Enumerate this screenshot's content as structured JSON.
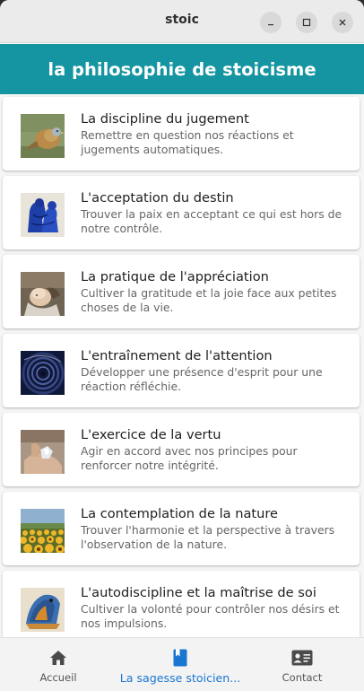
{
  "window": {
    "title": "stoic"
  },
  "appbar": {
    "title": "la philosophie de stoicisme",
    "color": "#1595a1"
  },
  "practices": [
    {
      "title": "La discipline du jugement",
      "subtitle": "Remettre en question nos réactions et jugements automatiques.",
      "image": "bird-painting"
    },
    {
      "title": "L'acceptation du destin",
      "subtitle": "Trouver la paix en acceptant ce qui est hors de notre contrôle.",
      "image": "blue-figures"
    },
    {
      "title": "La pratique de l'appréciation",
      "subtitle": "Cultiver la gratitude et la joie face aux petites choses de la vie.",
      "image": "child-portrait"
    },
    {
      "title": "L'entraînement de l'attention",
      "subtitle": "Développer une présence d'esprit pour une réaction réfléchie.",
      "image": "spiral-swirl"
    },
    {
      "title": "L'exercice de la vertu",
      "subtitle": "Agir en accord avec nos principes pour renforcer notre intégrité.",
      "image": "hands-crystal"
    },
    {
      "title": "La contemplation de la nature",
      "subtitle": "Trouver l'harmonie et la perspective à travers l'observation de la nature.",
      "image": "sunflower-field"
    },
    {
      "title": "L'autodiscipline et la maîtrise de soi",
      "subtitle": "Cultiver la volonté pour contrôler nos désirs et nos impulsions.",
      "image": "mosaic-bird"
    }
  ],
  "bottom_nav": {
    "items": [
      {
        "label": "Accueil",
        "icon": "home-icon",
        "active": false
      },
      {
        "label": "La sagesse stoicien...",
        "icon": "book-icon",
        "active": true
      },
      {
        "label": "Contact",
        "icon": "contact-card-icon",
        "active": false
      }
    ],
    "active_color": "#1976d2"
  }
}
